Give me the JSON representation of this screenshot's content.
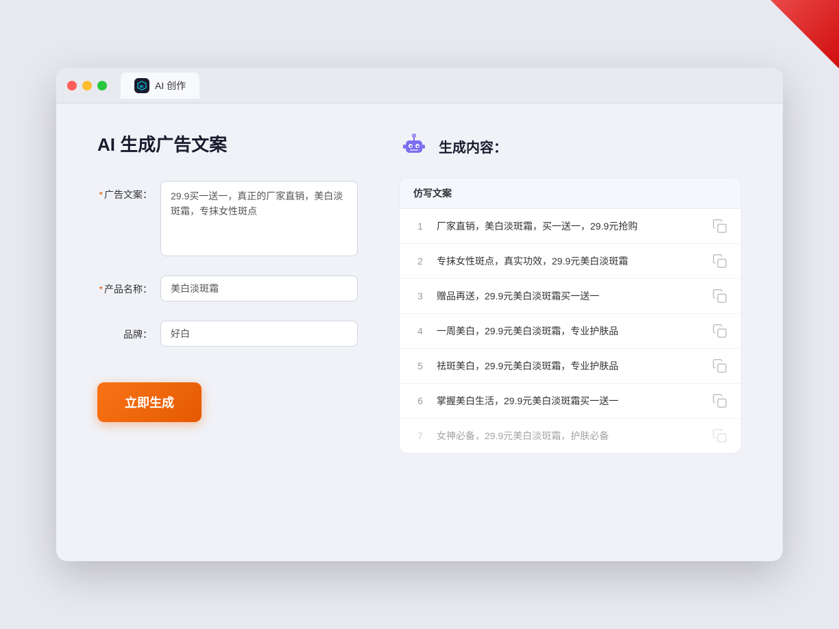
{
  "window": {
    "tab_icon": "AI",
    "tab_label": "AI 创作"
  },
  "left_panel": {
    "title": "AI 生成广告文案",
    "fields": [
      {
        "label": "广告文案：",
        "required": true,
        "type": "textarea",
        "value": "29.9买一送一，真正的厂家直销，美白淡斑霜，专抹女性斑点",
        "name": "ad-copy-input"
      },
      {
        "label": "产品名称：",
        "required": true,
        "type": "input",
        "value": "美白淡斑霜",
        "name": "product-name-input"
      },
      {
        "label": "品牌：",
        "required": false,
        "type": "input",
        "value": "好白",
        "name": "brand-input"
      }
    ],
    "generate_button": "立即生成"
  },
  "right_panel": {
    "title": "生成内容：",
    "table_header": "仿写文案",
    "results": [
      {
        "id": 1,
        "text": "厂家直销，美白淡斑霜，买一送一，29.9元抢购",
        "faded": false
      },
      {
        "id": 2,
        "text": "专抹女性斑点，真实功效，29.9元美白淡斑霜",
        "faded": false
      },
      {
        "id": 3,
        "text": "赠品再送，29.9元美白淡斑霜买一送一",
        "faded": false
      },
      {
        "id": 4,
        "text": "一周美白，29.9元美白淡斑霜，专业护肤品",
        "faded": false
      },
      {
        "id": 5,
        "text": "祛斑美白，29.9元美白淡斑霜，专业护肤品",
        "faded": false
      },
      {
        "id": 6,
        "text": "掌握美白生活，29.9元美白淡斑霜买一送一",
        "faded": false
      },
      {
        "id": 7,
        "text": "女神必备，29.9元美白淡斑霜，护肤必备",
        "faded": true
      }
    ]
  },
  "colors": {
    "accent_orange": "#f97316",
    "ai_blue": "#6c8fff",
    "required_star": "#e05a00"
  }
}
